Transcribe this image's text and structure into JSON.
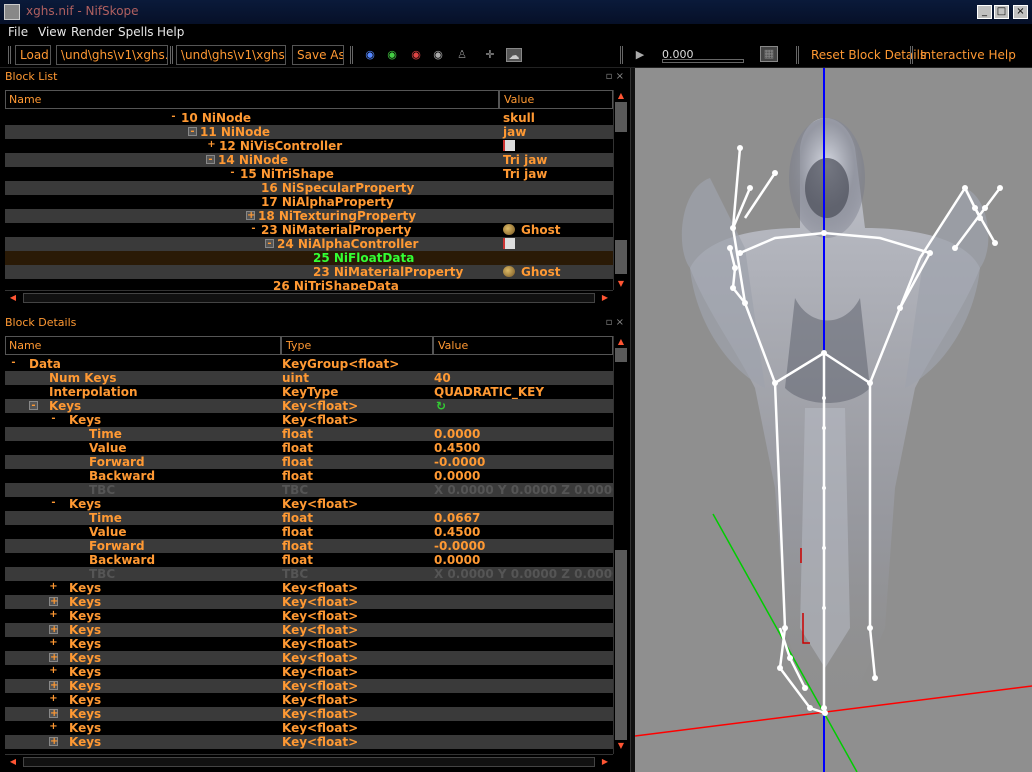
{
  "window": {
    "title": "xghs.nif - NifSkope",
    "minimize": "_",
    "maximize": "□",
    "close": "×"
  },
  "menu": [
    "File",
    "View",
    "Render",
    "Spells",
    "Help"
  ],
  "toolbar": {
    "load_label": "Load",
    "load_path": "\\und\\ghs\\v1\\xghs.nif",
    "save_path": "\\und\\ghs\\v1\\xghs.nif",
    "save_label": "Save As",
    "time_value": "0.000",
    "reset_label": "Reset Block Details",
    "help_label": "Interactive Help"
  },
  "block_list": {
    "title": "Block List",
    "col_name": "Name",
    "col_value": "Value",
    "rows": [
      {
        "exp": "-",
        "indent": 172,
        "name": "10 NiNode",
        "value": "skull",
        "icon": "",
        "alt": false,
        "style": ""
      },
      {
        "exp": "box-",
        "indent": 191,
        "name": "11 NiNode",
        "value": "jaw",
        "icon": "",
        "alt": true,
        "style": ""
      },
      {
        "exp": "+",
        "indent": 210,
        "name": "12 NiVisController",
        "value": "",
        "icon": "flag-icon",
        "alt": false,
        "style": ""
      },
      {
        "exp": "box-",
        "indent": 209,
        "name": "14 NiNode",
        "value": "Tri jaw",
        "icon": "",
        "alt": true,
        "style": ""
      },
      {
        "exp": "-",
        "indent": 231,
        "name": "15 NiTriShape",
        "value": "Tri jaw",
        "icon": "",
        "alt": false,
        "style": ""
      },
      {
        "exp": "",
        "indent": 252,
        "name": "16 NiSpecularProperty",
        "value": "",
        "icon": "",
        "alt": true,
        "style": ""
      },
      {
        "exp": "",
        "indent": 252,
        "name": "17 NiAlphaProperty",
        "value": "",
        "icon": "",
        "alt": false,
        "style": ""
      },
      {
        "exp": "box+",
        "indent": 249,
        "name": "18 NiTexturingProperty",
        "value": "",
        "icon": "",
        "alt": true,
        "style": ""
      },
      {
        "exp": "-",
        "indent": 252,
        "name": "23 NiMaterialProperty",
        "value": "Ghost",
        "icon": "palette-icon",
        "alt": false,
        "style": ""
      },
      {
        "exp": "box-",
        "indent": 268,
        "name": "24 NiAlphaController",
        "value": "",
        "icon": "flag-icon",
        "alt": true,
        "style": ""
      },
      {
        "exp": "",
        "indent": 304,
        "name": "25 NiFloatData",
        "value": "",
        "icon": "",
        "alt": false,
        "style": "sel"
      },
      {
        "exp": "",
        "indent": 304,
        "name": "23 NiMaterialProperty",
        "value": "Ghost",
        "icon": "palette-icon",
        "alt": true,
        "style": ""
      },
      {
        "exp": "",
        "indent": 264,
        "name": "26 NiTriShapeData",
        "value": "",
        "icon": "",
        "alt": false,
        "style": ""
      }
    ]
  },
  "block_details": {
    "title": "Block Details",
    "col_name": "Name",
    "col_type": "Type",
    "col_value": "Value",
    "rows": [
      {
        "exp": "-",
        "indent": 24,
        "name": "Data",
        "type": "KeyGroup<float>",
        "value": "",
        "alt": false,
        "dim": false
      },
      {
        "exp": "",
        "indent": 44,
        "name": "Num Keys",
        "type": "uint",
        "value": "40",
        "alt": true,
        "dim": false
      },
      {
        "exp": "",
        "indent": 44,
        "name": "Interpolation",
        "type": "KeyType",
        "value": "QUADRATIC_KEY",
        "alt": false,
        "dim": false
      },
      {
        "exp": "box-",
        "indent": 44,
        "name": "Keys",
        "type": "Key<float>",
        "value": "",
        "alt": true,
        "dim": false,
        "arrow": true
      },
      {
        "exp": "-",
        "indent": 64,
        "name": "Keys",
        "type": "Key<float>",
        "value": "",
        "alt": false,
        "dim": false
      },
      {
        "exp": "",
        "indent": 84,
        "name": "Time",
        "type": "float",
        "value": "0.0000",
        "alt": true,
        "dim": false
      },
      {
        "exp": "",
        "indent": 84,
        "name": "Value",
        "type": "float",
        "value": "0.4500",
        "alt": false,
        "dim": false
      },
      {
        "exp": "",
        "indent": 84,
        "name": "Forward",
        "type": "float",
        "value": "-0.0000",
        "alt": true,
        "dim": false
      },
      {
        "exp": "",
        "indent": 84,
        "name": "Backward",
        "type": "float",
        "value": "0.0000",
        "alt": false,
        "dim": false
      },
      {
        "exp": "",
        "indent": 84,
        "name": "TBC",
        "type": "TBC",
        "value": "X 0.0000 Y 0.0000 Z 0.0000",
        "alt": true,
        "dim": true
      },
      {
        "exp": "-",
        "indent": 64,
        "name": "Keys",
        "type": "Key<float>",
        "value": "",
        "alt": false,
        "dim": false
      },
      {
        "exp": "",
        "indent": 84,
        "name": "Time",
        "type": "float",
        "value": "0.0667",
        "alt": true,
        "dim": false
      },
      {
        "exp": "",
        "indent": 84,
        "name": "Value",
        "type": "float",
        "value": "0.4500",
        "alt": false,
        "dim": false
      },
      {
        "exp": "",
        "indent": 84,
        "name": "Forward",
        "type": "float",
        "value": "-0.0000",
        "alt": true,
        "dim": false
      },
      {
        "exp": "",
        "indent": 84,
        "name": "Backward",
        "type": "float",
        "value": "0.0000",
        "alt": false,
        "dim": false
      },
      {
        "exp": "",
        "indent": 84,
        "name": "TBC",
        "type": "TBC",
        "value": "X 0.0000 Y 0.0000 Z 0.0000",
        "alt": true,
        "dim": true
      },
      {
        "exp": "+",
        "indent": 64,
        "name": "Keys",
        "type": "Key<float>",
        "value": "",
        "alt": false,
        "dim": false
      },
      {
        "exp": "box+",
        "indent": 64,
        "name": "Keys",
        "type": "Key<float>",
        "value": "",
        "alt": true,
        "dim": false
      },
      {
        "exp": "+",
        "indent": 64,
        "name": "Keys",
        "type": "Key<float>",
        "value": "",
        "alt": false,
        "dim": false
      },
      {
        "exp": "box+",
        "indent": 64,
        "name": "Keys",
        "type": "Key<float>",
        "value": "",
        "alt": true,
        "dim": false
      },
      {
        "exp": "+",
        "indent": 64,
        "name": "Keys",
        "type": "Key<float>",
        "value": "",
        "alt": false,
        "dim": false
      },
      {
        "exp": "box+",
        "indent": 64,
        "name": "Keys",
        "type": "Key<float>",
        "value": "",
        "alt": true,
        "dim": false
      },
      {
        "exp": "+",
        "indent": 64,
        "name": "Keys",
        "type": "Key<float>",
        "value": "",
        "alt": false,
        "dim": false
      },
      {
        "exp": "box+",
        "indent": 64,
        "name": "Keys",
        "type": "Key<float>",
        "value": "",
        "alt": true,
        "dim": false
      },
      {
        "exp": "+",
        "indent": 64,
        "name": "Keys",
        "type": "Key<float>",
        "value": "",
        "alt": false,
        "dim": false
      },
      {
        "exp": "box+",
        "indent": 64,
        "name": "Keys",
        "type": "Key<float>",
        "value": "",
        "alt": true,
        "dim": false
      },
      {
        "exp": "+",
        "indent": 64,
        "name": "Keys",
        "type": "Key<float>",
        "value": "",
        "alt": false,
        "dim": false
      },
      {
        "exp": "box+",
        "indent": 64,
        "name": "Keys",
        "type": "Key<float>",
        "value": "",
        "alt": true,
        "dim": false
      }
    ]
  },
  "colors": {
    "text": "#ff9933",
    "selected_text": "#33ff33",
    "viewport_bg": "#8f8f8f",
    "axis_x": "#ff0000",
    "axis_y": "#00cc00",
    "axis_z": "#0000ff"
  }
}
